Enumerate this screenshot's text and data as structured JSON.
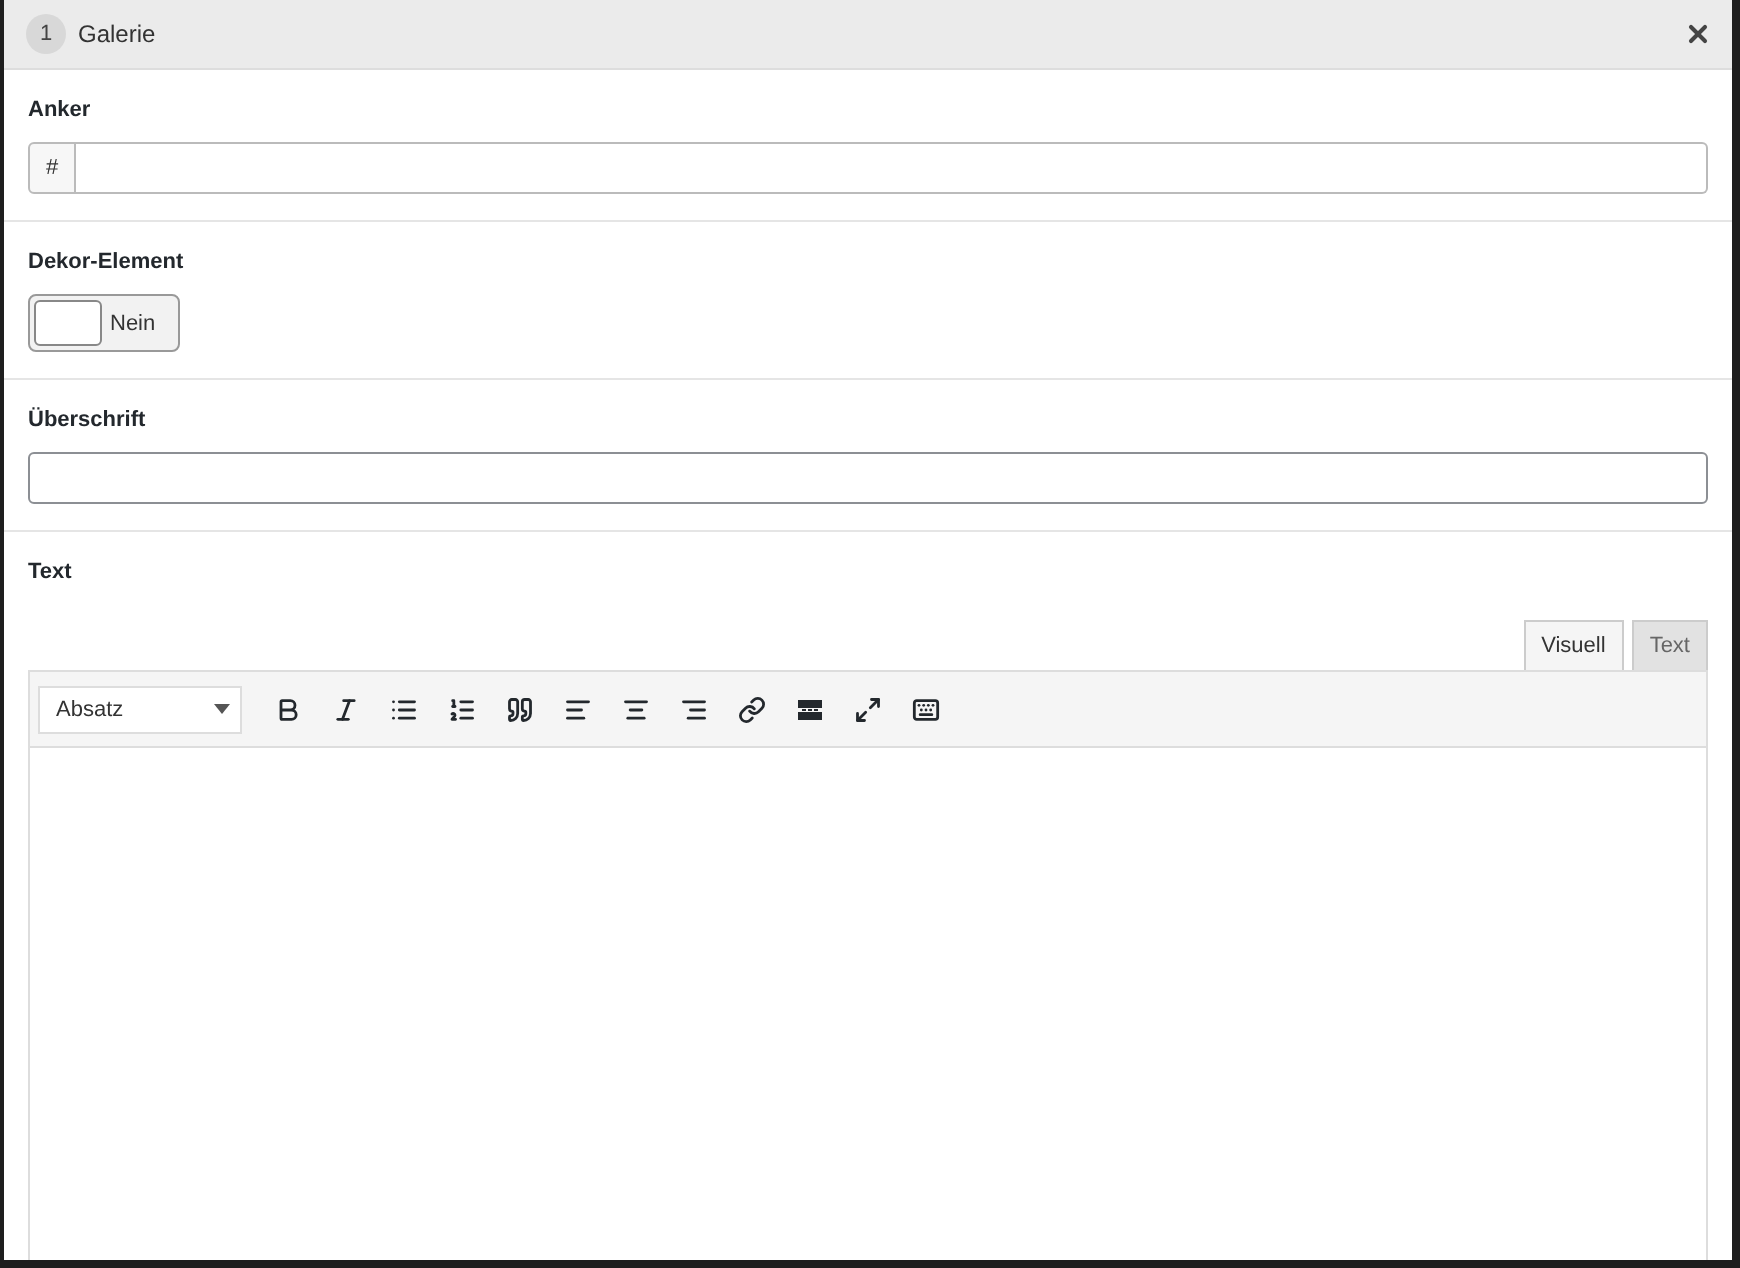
{
  "header": {
    "number": "1",
    "title": "Galerie"
  },
  "anchor": {
    "label": "Anker",
    "prefix": "#"
  },
  "decor": {
    "label": "Dekor-Element",
    "on": false,
    "state_label": "Nein"
  },
  "heading": {
    "label": "Überschrift"
  },
  "text": {
    "label": "Text",
    "tabs": [
      {
        "label": "Visuell",
        "selected": true
      },
      {
        "label": "Text",
        "selected": false
      }
    ],
    "format": "Absatz"
  }
}
